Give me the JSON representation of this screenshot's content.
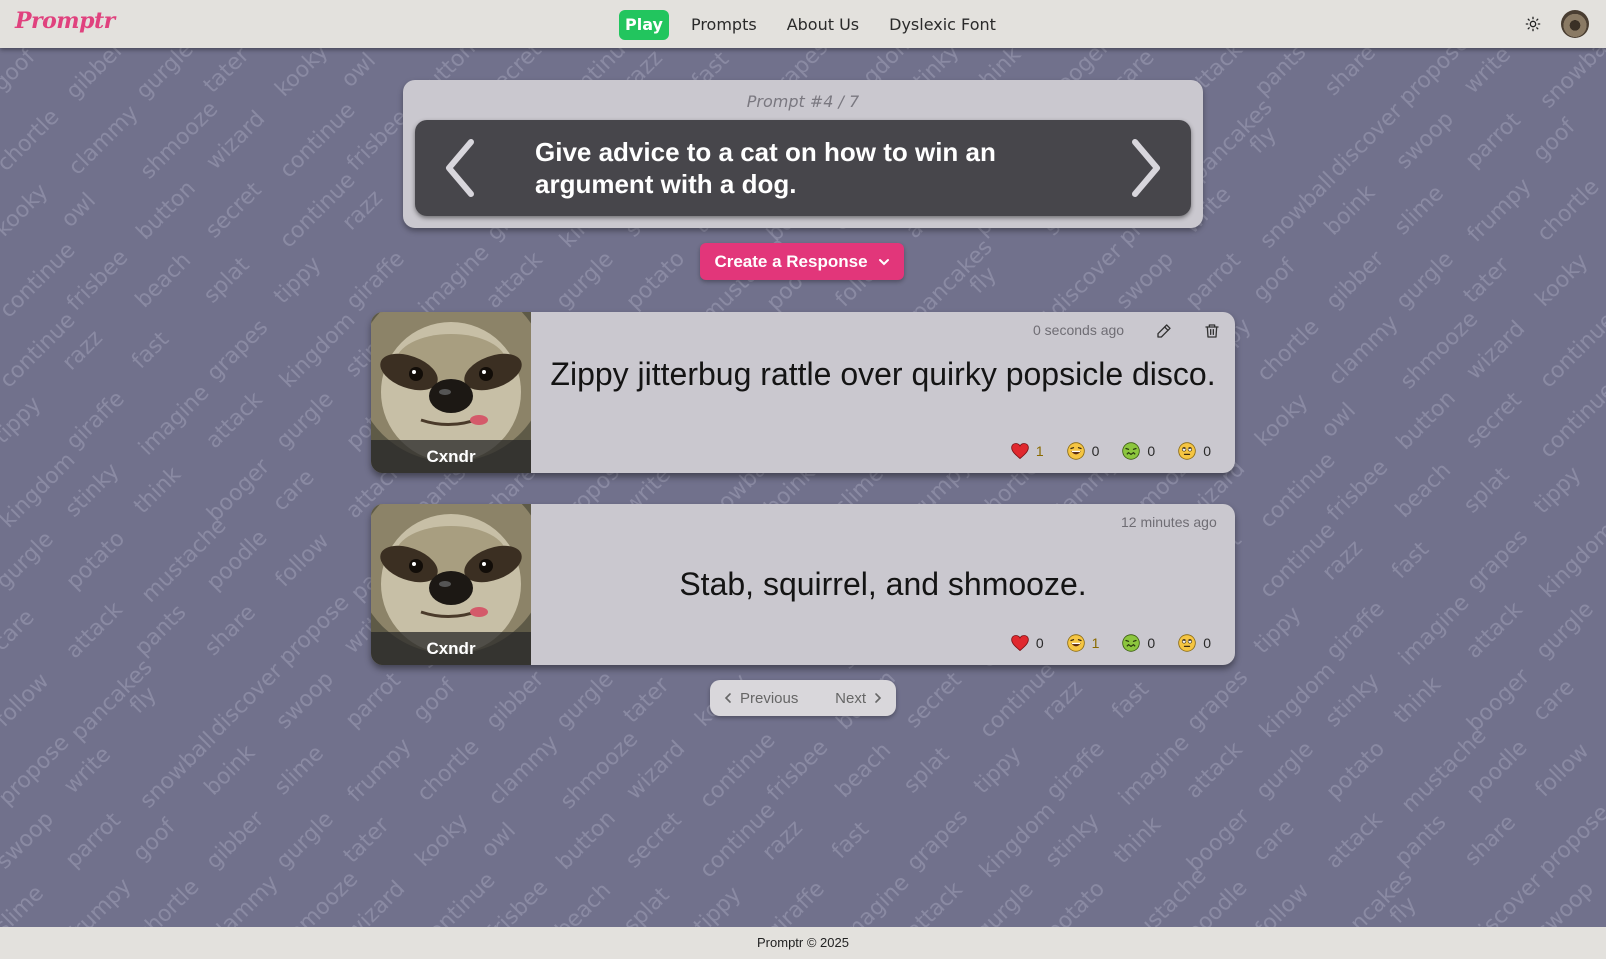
{
  "header": {
    "logo": "Promptr",
    "nav": [
      {
        "label": "Play",
        "active": true
      },
      {
        "label": "Prompts",
        "active": false
      },
      {
        "label": "About Us",
        "active": false
      },
      {
        "label": "Dyslexic Font",
        "active": false
      }
    ],
    "theme_icon": "sun-icon",
    "avatar_icon": "sloth-avatar"
  },
  "prompt": {
    "counter": "Prompt #4 / 7",
    "text": "Give advice to a cat on how to win an argument with a dog.",
    "prev_icon": "chevron-left-icon",
    "next_icon": "chevron-right-icon"
  },
  "create_button": {
    "label": "Create a Response",
    "icon": "chevron-down-icon",
    "color": "#e2367a"
  },
  "responses": [
    {
      "username": "Cxndr",
      "time": "0 seconds ago",
      "text": "Zippy jitterbug rattle over quirky popsicle disco.",
      "editable": true,
      "reactions": [
        {
          "icon": "heart-icon",
          "count": "1",
          "active": true
        },
        {
          "icon": "laughing-icon",
          "count": "0",
          "active": false
        },
        {
          "icon": "sick-icon",
          "count": "0",
          "active": false
        },
        {
          "icon": "eyeroll-icon",
          "count": "0",
          "active": false
        }
      ]
    },
    {
      "username": "Cxndr",
      "time": "12 minutes ago",
      "text": "Stab, squirrel, and shmooze.",
      "editable": false,
      "reactions": [
        {
          "icon": "heart-icon",
          "count": "0",
          "active": false
        },
        {
          "icon": "laughing-icon",
          "count": "1",
          "active": true
        },
        {
          "icon": "sick-icon",
          "count": "0",
          "active": false
        },
        {
          "icon": "eyeroll-icon",
          "count": "0",
          "active": false
        }
      ]
    }
  ],
  "pager": {
    "previous": "Previous",
    "next": "Next"
  },
  "footer": {
    "text": "Promptr © 2025"
  },
  "background_words": [
    "goof",
    "gibber",
    "gurgle",
    "tater",
    "kooky",
    "owl",
    "button",
    "secret",
    "continue",
    "razz",
    "fast",
    "grapes",
    "kingdom",
    "stinky",
    "think",
    "booger",
    "care",
    "attack",
    "pants",
    "share",
    "propose",
    "write",
    "snowball",
    "boink",
    "slime",
    "frumpy",
    "chortle",
    "clammy",
    "shmooze",
    "wizard",
    "continue",
    "frisbee",
    "beach",
    "splat",
    "tippy",
    "giraffe",
    "imagine",
    "attack",
    "gurgle",
    "potato",
    "mustache",
    "poodle",
    "follow",
    "pancakes",
    "fly",
    "discover",
    "swoop",
    "parrot"
  ],
  "colors": {
    "background": "#71718c",
    "header": "#e3e1dd",
    "card": "#cac8cf",
    "prompt_inner": "#47464b",
    "nav_active": "#22c55e",
    "accent": "#e2367a"
  }
}
